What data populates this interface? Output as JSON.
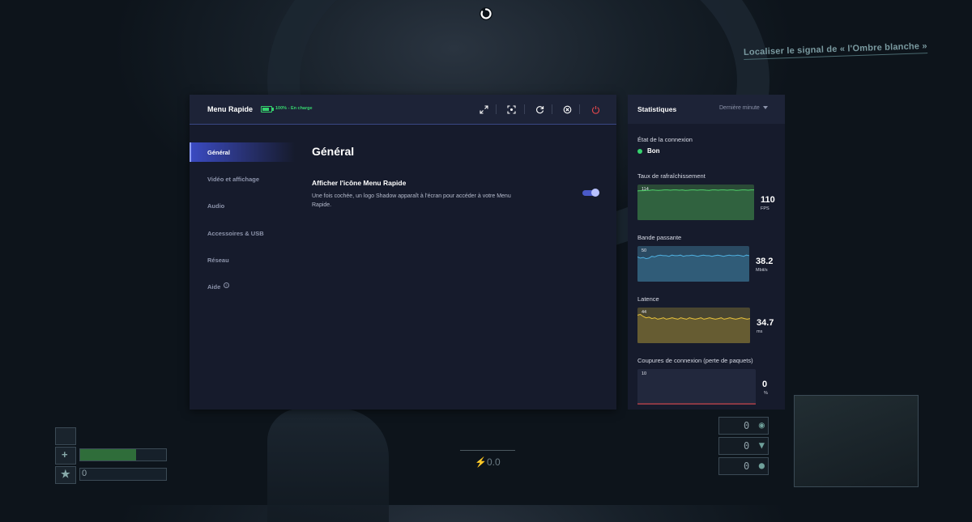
{
  "game": {
    "objective": "Localiser le signal de « l'Ombre blanche »",
    "hud_left_value": "0",
    "hud_center": "⚡0.0",
    "hud_right_counters": [
      "0",
      "0",
      "0"
    ],
    "health_fraction": 0.65
  },
  "quick_menu": {
    "title": "Menu Rapide",
    "battery_text": "100% - En charge",
    "battery_fraction": 1.0,
    "header_buttons": [
      {
        "name": "fullscreen-icon",
        "color": "#ffffff"
      },
      {
        "name": "screenshot-icon",
        "color": "#ffffff"
      },
      {
        "name": "refresh-icon",
        "color": "#ffffff"
      },
      {
        "name": "close-icon",
        "color": "#ffffff"
      },
      {
        "name": "power-icon",
        "color": "#e0474c"
      }
    ],
    "sidebar": [
      {
        "label": "Général",
        "active": true
      },
      {
        "label": "Vidéo et affichage",
        "active": false
      },
      {
        "label": "Audio",
        "active": false
      },
      {
        "label": "Accessoires & USB",
        "active": false
      },
      {
        "label": "Réseau",
        "active": false
      },
      {
        "label": "Aide",
        "active": false,
        "icon": "help-circle-icon"
      }
    ],
    "content": {
      "title": "Général",
      "setting": {
        "title": "Afficher l'icône Menu Rapide",
        "description": "Une fois cochée, un logo Shadow apparaît à l'écran pour accéder à votre Menu Rapide.",
        "enabled": true
      }
    },
    "accent_color": "#4a5ac8"
  },
  "stats": {
    "title": "Statistiques",
    "period": "Dernière minute",
    "connection": {
      "label": "État de la connexion",
      "status": "Bon",
      "color": "#36d36e"
    },
    "graphs": [
      {
        "label": "Taux de rafraîchissement",
        "max": "114",
        "value": "110",
        "unit": "FPS",
        "color": "#4fd16a",
        "fill": "#2a4a36",
        "series": [
          108,
          109,
          109,
          110,
          110,
          112,
          111,
          110,
          111,
          112,
          112,
          111,
          112,
          112,
          111,
          112,
          110,
          111,
          112,
          112,
          111,
          112,
          112,
          111,
          110,
          112,
          112,
          111,
          112,
          112,
          111,
          112,
          112,
          110,
          111,
          112,
          112,
          111,
          112,
          112
        ]
      },
      {
        "label": "Bande passante",
        "max": "50",
        "value": "38.2",
        "unit": "Mbit/s",
        "color": "#4fb0e0",
        "fill": "#2a4a62",
        "series": [
          40,
          38,
          39,
          37,
          38,
          41,
          40,
          42,
          43,
          42,
          42,
          41,
          43,
          42,
          42,
          43,
          41,
          42,
          42,
          43,
          42,
          41,
          42,
          43,
          42,
          42,
          41,
          42,
          43,
          42,
          41,
          42,
          43,
          42,
          42,
          43,
          42,
          41,
          43,
          42
        ]
      },
      {
        "label": "Latence",
        "max": "44",
        "value": "34.7",
        "unit": "ms",
        "color": "#e8c23c",
        "fill": "#4a4630",
        "series": [
          40,
          41,
          38,
          36,
          37,
          35,
          36,
          34,
          35,
          36,
          34,
          35,
          36,
          35,
          34,
          36,
          35,
          34,
          36,
          35,
          34,
          35,
          36,
          34,
          35,
          36,
          35,
          34,
          35,
          36,
          34,
          35,
          36,
          35,
          34,
          35,
          36,
          35,
          34,
          35
        ]
      },
      {
        "label": "Coupures de connexion (perte de paquets)",
        "max": "10",
        "value": "0",
        "unit": "%",
        "color": "#e0474c",
        "fill": "#22283d",
        "series": [
          0,
          0,
          0,
          0,
          0,
          0,
          0,
          0,
          0,
          0,
          0,
          0,
          0,
          0,
          0,
          0,
          0,
          0,
          0,
          0
        ]
      }
    ]
  }
}
